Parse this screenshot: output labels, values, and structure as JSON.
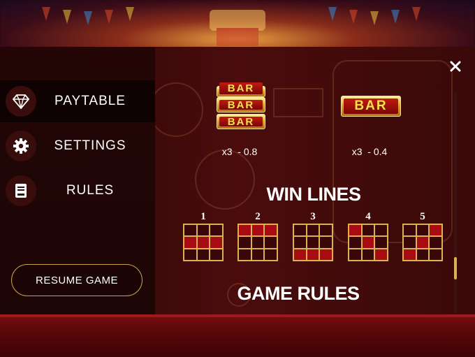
{
  "menu": {
    "items": [
      {
        "label": "PAYTABLE",
        "icon": "diamond-icon",
        "active": true
      },
      {
        "label": "SETTINGS",
        "icon": "gear-icon",
        "active": false
      },
      {
        "label": "RULES",
        "icon": "book-icon",
        "active": false
      }
    ],
    "resume_label": "RESUME GAME"
  },
  "paytable": {
    "symbol_text": "BAR",
    "entries": [
      {
        "symbol": "triple-bar",
        "value": "x3  - 0.8"
      },
      {
        "symbol": "single-bar",
        "value": "x3  - 0.4"
      }
    ]
  },
  "win_lines": {
    "title": "WIN LINES",
    "lines": [
      {
        "label": "1",
        "cells": [
          0,
          0,
          0,
          1,
          1,
          1,
          0,
          0,
          0
        ]
      },
      {
        "label": "2",
        "cells": [
          1,
          1,
          1,
          0,
          0,
          0,
          0,
          0,
          0
        ]
      },
      {
        "label": "3",
        "cells": [
          0,
          0,
          0,
          0,
          0,
          0,
          1,
          1,
          1
        ]
      },
      {
        "label": "4",
        "cells": [
          1,
          0,
          0,
          0,
          1,
          0,
          0,
          0,
          1
        ]
      },
      {
        "label": "5",
        "cells": [
          0,
          0,
          1,
          0,
          1,
          0,
          1,
          0,
          0
        ]
      }
    ]
  },
  "game_rules": {
    "title": "GAME RULES"
  },
  "colors": {
    "accent_gold": "#d9b254",
    "active_cell": "#a80c12",
    "panel": "#2a0708"
  }
}
